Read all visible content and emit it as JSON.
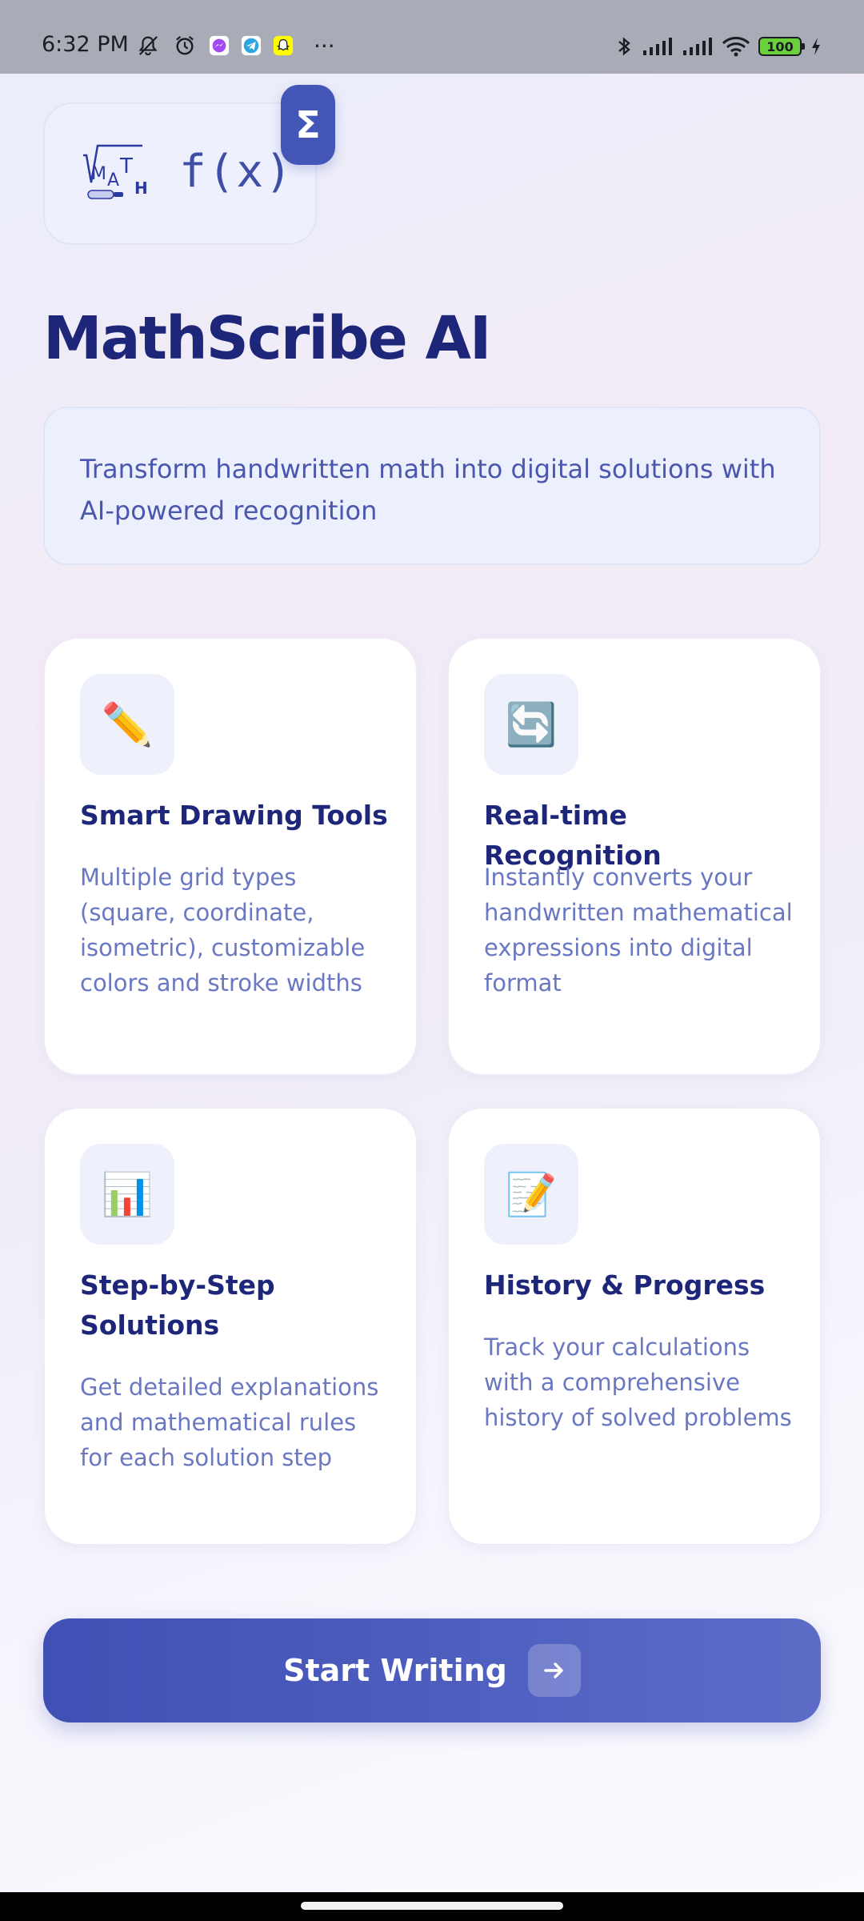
{
  "status_bar": {
    "time": "6:32 PM",
    "overflow": "···",
    "battery": "100",
    "icons_left": [
      "mute-bell-icon",
      "alarm-icon",
      "messenger-icon",
      "telegram-icon",
      "snapchat-icon"
    ],
    "icons_right": [
      "bluetooth-icon",
      "signal-icon",
      "signal-icon",
      "wifi-icon",
      "battery-icon",
      "charging-icon"
    ]
  },
  "header": {
    "logo_name": "math-logo-icon",
    "fx_text": "f(x)",
    "badge_symbol": "Σ"
  },
  "app": {
    "title": "MathScribe AI",
    "subtitle": "Transform handwritten math into digital solutions with AI-powered recognition"
  },
  "features": [
    {
      "icon": "✏️",
      "icon_name": "pencil-icon",
      "title": "Smart Drawing Tools",
      "description": "Multiple grid types (square, coordinate, isometric), customizable colors and stroke widths"
    },
    {
      "icon": "🔄",
      "icon_name": "refresh-icon",
      "title": "Real-time Recognition",
      "description": "Instantly converts your handwritten mathematical expressions into digital format"
    },
    {
      "icon": "📊",
      "icon_name": "bar-chart-icon",
      "title": "Step-by-Step Solutions",
      "description": "Get detailed explanations and mathematical rules for each solution step"
    },
    {
      "icon": "📝",
      "icon_name": "memo-icon",
      "title": "History & Progress",
      "description": "Track your calculations with a comprehensive history of solved problems"
    }
  ],
  "cta": {
    "label": "Start Writing",
    "icon": "arrow-right-icon"
  },
  "colors": {
    "primary": "#4356b8",
    "title": "#1e267a",
    "text_muted": "#6a78c2",
    "card_bg": "#ffffff",
    "icon_box_bg": "#eef0fb"
  }
}
